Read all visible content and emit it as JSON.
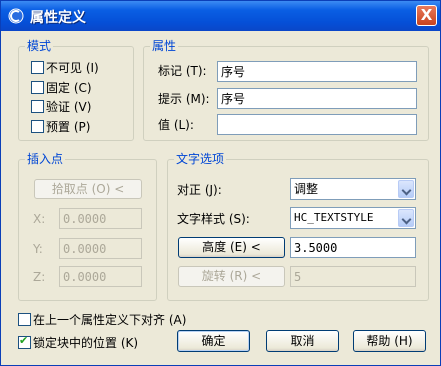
{
  "dialog": {
    "title": "属性定义",
    "close_label": "X"
  },
  "mode": {
    "legend": "模式",
    "options": [
      {
        "label": "不可见 (I)",
        "checked": false
      },
      {
        "label": "固定 (C)",
        "checked": false
      },
      {
        "label": "验证 (V)",
        "checked": false
      },
      {
        "label": "预置 (P)",
        "checked": false
      }
    ]
  },
  "attribute": {
    "legend": "属性",
    "tag_label": "标记 (T):",
    "tag_value": "序号",
    "prompt_label": "提示 (M):",
    "prompt_value": "序号",
    "value_label": "值 (L):",
    "value_value": ""
  },
  "insert_point": {
    "legend": "插入点",
    "pick_button": "拾取点 (O) <",
    "x_label": "X:",
    "x_value": "0.0000",
    "y_label": "Y:",
    "y_value": "0.0000",
    "z_label": "Z:",
    "z_value": "0.0000"
  },
  "text_options": {
    "legend": "文字选项",
    "justify_label": "对正 (J):",
    "justify_value": "调整",
    "style_label": "文字样式 (S):",
    "style_value": "HC_TEXTSTYLE",
    "height_button": "高度 (E) <",
    "height_value": "3.5000",
    "rotate_button": "旋转 (R) <",
    "rotate_value": "5"
  },
  "footer": {
    "align_below_label": "在上一个属性定义下对齐 (A)",
    "align_below_checked": false,
    "lock_position_label": "锁定块中的位置 (K)",
    "lock_position_checked": true,
    "ok_label": "确定",
    "cancel_label": "取消",
    "help_label": "帮助 (H)"
  }
}
